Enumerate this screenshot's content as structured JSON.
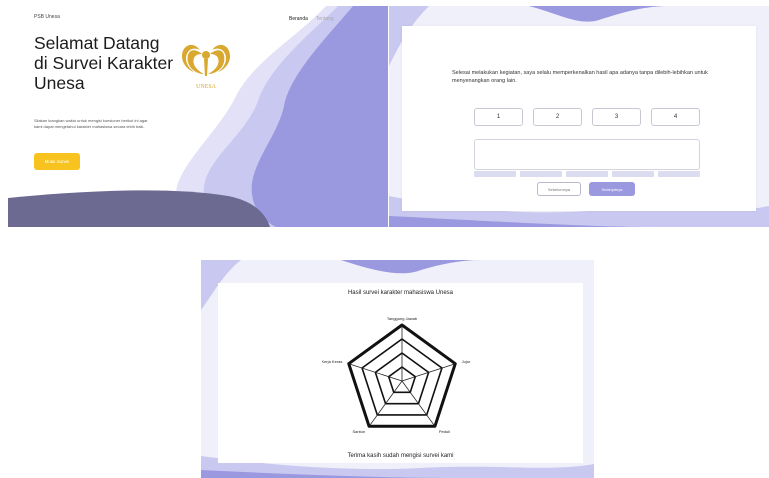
{
  "landing": {
    "brand": "PSB Unesa",
    "nav": [
      "Beranda",
      "Tentang"
    ],
    "title_lines": [
      "Selamat Datang",
      "di Survei Karakter",
      "Unesa"
    ],
    "description": "Silakan luangkan waktu untuk mengisi kuesioner berikut ini agar kami dapat mengetahui karakter mahasiswa secara lebih baik.",
    "cta_label": "Mulai Survei",
    "logo_text": "UNESA",
    "colors": {
      "accent": "#F8C31E",
      "purple": "#9A98DE",
      "light_purple": "#C9C8F0",
      "slate": "#6D6A92",
      "gold": "#D9A830"
    }
  },
  "survey": {
    "question": "Selesai melakukan kegiatan, saya selalu memperkenalkan hasil apa adanya tanpa dilebih-lebihkan untuk menyenangkan orang lain.",
    "options": [
      "1",
      "2",
      "3",
      "4"
    ],
    "prev_label": "Sebelumnya",
    "next_label": "Selanjutnya"
  },
  "result": {
    "title": "Hasil survei karakter mahasiswa Unesa",
    "thanks": "Terima kasih sudah mengisi survei kami",
    "axes": [
      "Tanggung Jawab",
      "Jujur",
      "Peduli",
      "Santun",
      "Kerja Keras"
    ],
    "values": [
      0.9,
      0.85,
      0.9,
      0.9,
      0.85
    ],
    "levels": 4
  }
}
